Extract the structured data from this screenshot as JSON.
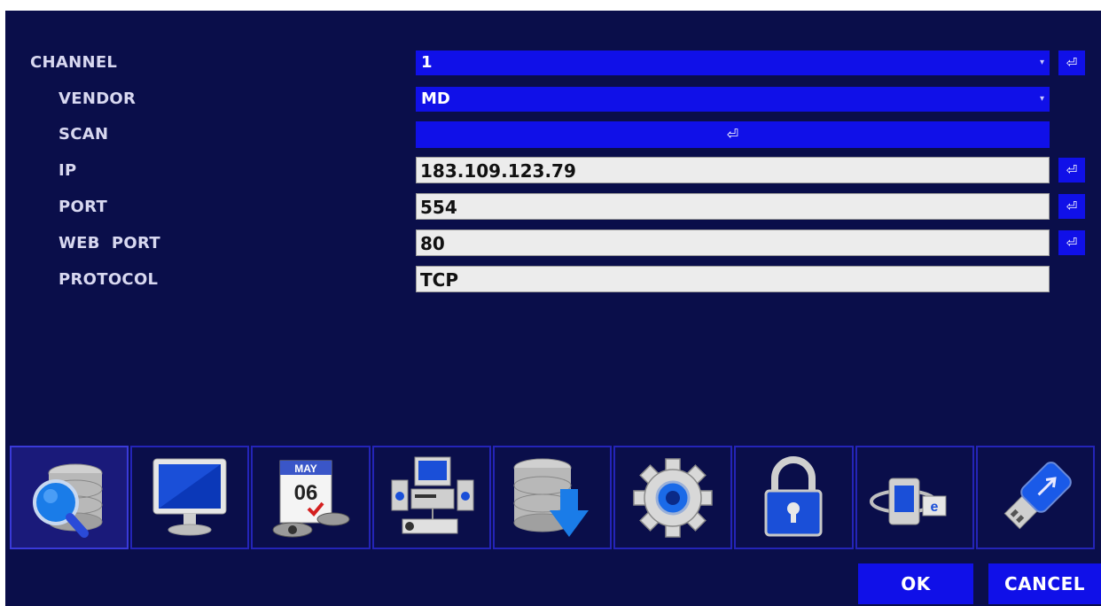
{
  "form": {
    "channel": {
      "label": "CHANNEL",
      "value": "1"
    },
    "vendor": {
      "label": "VENDOR",
      "value": "MD"
    },
    "scan": {
      "label": "SCAN"
    },
    "ip": {
      "label": "IP",
      "value": "183.109.123.79"
    },
    "port": {
      "label": "PORT",
      "value": "554"
    },
    "web_port": {
      "label": "WEB  PORT",
      "value": "80"
    },
    "protocol": {
      "label": "PROTOCOL",
      "value": "TCP"
    }
  },
  "enter_glyph": "⏎",
  "dropdown_glyph": "▾",
  "icons": [
    {
      "name": "database-search-icon",
      "active": true
    },
    {
      "name": "monitor-icon"
    },
    {
      "name": "calendar-icon",
      "month": "MAY",
      "day": "06"
    },
    {
      "name": "network-devices-icon"
    },
    {
      "name": "database-download-icon"
    },
    {
      "name": "gear-icon"
    },
    {
      "name": "lock-icon"
    },
    {
      "name": "web-icon",
      "badge": "e"
    },
    {
      "name": "usb-icon"
    }
  ],
  "buttons": {
    "ok": "OK",
    "cancel": "CANCEL"
  },
  "colors": {
    "background": "#0a0e4a",
    "accent_blue": "#1010e8",
    "field_white": "#ececec"
  }
}
